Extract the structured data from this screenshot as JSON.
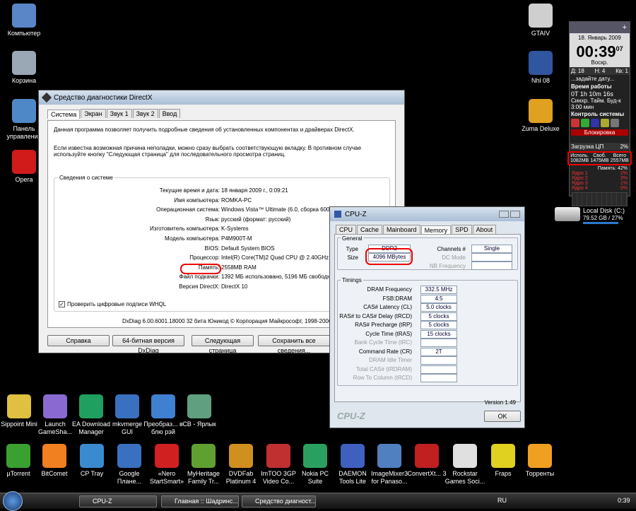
{
  "desktop": {
    "left_icons": [
      {
        "label": "Компьютер",
        "icon": "computer-icon",
        "color": "#5a86c8"
      },
      {
        "label": "Корзина",
        "icon": "recycle-bin-icon",
        "color": "#9aa7b5"
      },
      {
        "label": "Панель управления",
        "icon": "control-panel-icon",
        "color": "#4f88c6"
      },
      {
        "label": "Opera",
        "icon": "opera-icon",
        "color": "#d11a1a"
      }
    ],
    "right_icons": [
      {
        "label": "GTAIV",
        "icon": "gtaiv-icon",
        "color": "#cfcfcf"
      },
      {
        "label": "Nhl 08",
        "icon": "nhl08-icon",
        "color": "#3056a0"
      },
      {
        "label": "Zuma Deluxe",
        "icon": "zuma-icon",
        "color": "#e0a020"
      }
    ],
    "disk": {
      "label": "Local Disk (C:)",
      "info": "79.52 GB / 27%"
    },
    "bottom_row1": [
      {
        "label": "Sippoint Mini",
        "color": "#e0c040"
      },
      {
        "label": "Launch GameSha...",
        "color": "#8a6ad0"
      },
      {
        "label": "EA Download Manager",
        "color": "#20a060"
      },
      {
        "label": "mkvmerge GUI",
        "color": "#3a70c0"
      },
      {
        "label": "Преобраз... в блю рэй",
        "color": "#4080d0"
      },
      {
        "label": "CB - Ярлык",
        "color": "#60a080"
      }
    ],
    "bottom_row2": [
      {
        "label": "µTorrent",
        "color": "#3aa030"
      },
      {
        "label": "BitComet",
        "color": "#f08020"
      },
      {
        "label": "CP Tray",
        "color": "#3a8ad0"
      },
      {
        "label": "Google Плане...",
        "color": "#3a70c0"
      },
      {
        "label": "«Nero StartSmart»",
        "color": "#d02020"
      },
      {
        "label": "MyHeritage Family Tr...",
        "color": "#60a030"
      },
      {
        "label": "DVDFab Platinum 4",
        "color": "#d09020"
      },
      {
        "label": "ImTOO 3GP Video Co...",
        "color": "#c03030"
      },
      {
        "label": "Nokia PC Suite",
        "color": "#2aa060"
      },
      {
        "label": "DAEMON Tools Lite",
        "color": "#4060c0"
      },
      {
        "label": "ImageMixer3 for Panaso...",
        "color": "#5080c0"
      },
      {
        "label": "ConvertXt... 3",
        "color": "#c02020"
      },
      {
        "label": "Rockstar Games Soci...",
        "color": "#e0e0e0"
      },
      {
        "label": "Fraps",
        "color": "#e0d020"
      },
      {
        "label": "Торренты",
        "color": "#f0a020"
      }
    ]
  },
  "gadget": {
    "plus": "+",
    "date": "18. Январь 2009",
    "time": "00:39",
    "seconds": "07",
    "weekday": "Воскр.",
    "d_label": "Д: 18",
    "h_label": "Н: 4",
    "k_label": "Кв: 1",
    "task": "...задайте дату...",
    "uptime_title": "Время работы",
    "uptime": "0T 1h 10m 16s",
    "sync": "Синхр. Тайм. Буд-к",
    "alarm": "3:00 мин",
    "control": "Контроль системы",
    "lock": "Блокировка",
    "cpu_title": "Загрузка ЦП",
    "cpu_pct": "2%",
    "mem_used_lbl": "Исполь.",
    "mem_free_lbl": "Своб.",
    "mem_total_lbl": "Всего",
    "mem_used": "1082MB",
    "mem_free": "1475MB",
    "mem_total": "2557MB",
    "mem_pct": "Память: 42%",
    "cores": [
      {
        "name": "Ядро 1",
        "v": "2%"
      },
      {
        "name": "Ядро 2",
        "v": "3%"
      },
      {
        "name": "Ядро 3",
        "v": "1%"
      },
      {
        "name": "Ядро 4",
        "v": "0%"
      }
    ]
  },
  "dxdiag": {
    "title": "Средство диагностики DirectX",
    "tabs": [
      "Система",
      "Экран",
      "Звук 1",
      "Звук 2",
      "Ввод"
    ],
    "intro1": "Данная программа позволяет получить подробные сведения об установленных компонентах и драйверах DirectX.",
    "intro2": "Если известна возможная причина неполадки, можно сразу выбрать соответствующую вкладку. В противном случае используйте кнопку \"Следующая страница\" для последовательного просмотра страниц.",
    "group": "Сведения о системе",
    "rows": [
      {
        "k": "Текущие время и дата:",
        "v": "18 января 2009 г., 0:09:21"
      },
      {
        "k": "Имя компьютера:",
        "v": "ROMKA-PC"
      },
      {
        "k": "Операционная система:",
        "v": "Windows Vista™ Ultimate (6.0, сборка 6001)"
      },
      {
        "k": "Язык:",
        "v": "русский (формат: русский)"
      },
      {
        "k": "Изготовитель компьютера:",
        "v": "K-Systems"
      },
      {
        "k": "Модель компьютера:",
        "v": "P4M900T-M"
      },
      {
        "k": "BIOS:",
        "v": "Default System BIOS"
      },
      {
        "k": "Процессор:",
        "v": "Intel(R) Core(TM)2 Quad CPU          @ 2.40GHz (4 CPUs), ~2"
      },
      {
        "k": "Память:",
        "v": "2558MB RAM"
      },
      {
        "k": "Файл подкачки:",
        "v": "1392 МБ использовано, 5196 МБ свободно"
      },
      {
        "k": "Версия DirectX:",
        "v": "DirectX 10"
      }
    ],
    "checkbox": "Проверить цифровые подписи WHQL",
    "footer": "DxDiag 6.00.6001.18000 32 бита Юникод  © Корпорация Майкрософт, 1998-2006",
    "buttons": [
      "Справка",
      "64-битная версия DxDiag",
      "Следующая страница",
      "Сохранить все сведения..."
    ]
  },
  "cpuz": {
    "title": "CPU-Z",
    "tabs": [
      "CPU",
      "Cache",
      "Mainboard",
      "Memory",
      "SPD",
      "About"
    ],
    "general": "General",
    "type_lbl": "Type",
    "type": "DDR2",
    "size_lbl": "Size",
    "size": "4096 MBytes",
    "channels_lbl": "Channels #",
    "channels": "Single",
    "dc_lbl": "DC Mode",
    "nb_lbl": "NB Frequency",
    "timings": "Timings",
    "trows": [
      {
        "k": "DRAM Frequency",
        "v": "332.5 MHz",
        "on": true
      },
      {
        "k": "FSB:DRAM",
        "v": "4:5",
        "on": true
      },
      {
        "k": "CAS# Latency (CL)",
        "v": "5.0 clocks",
        "on": true
      },
      {
        "k": "RAS# to CAS# Delay (tRCD)",
        "v": "5 clocks",
        "on": true
      },
      {
        "k": "RAS# Precharge (tRP)",
        "v": "5 clocks",
        "on": true
      },
      {
        "k": "Cycle Time (tRAS)",
        "v": "15 clocks",
        "on": true
      },
      {
        "k": "Bank Cycle Time (tRC)",
        "v": "",
        "on": false
      },
      {
        "k": "Command Rate (CR)",
        "v": "2T",
        "on": true
      },
      {
        "k": "DRAM Idle Timer",
        "v": "",
        "on": false
      },
      {
        "k": "Total CAS# (tRDRAM)",
        "v": "",
        "on": false
      },
      {
        "k": "Row To Column (tRCD)",
        "v": "",
        "on": false
      }
    ],
    "version": "Version 1.49",
    "brand": "CPU-Z",
    "ok": "OK"
  },
  "taskbar": {
    "items": [
      "CPU-Z",
      "Главная :: Шадринс...",
      "Средство диагност..."
    ],
    "lang": "RU",
    "clock": "0:39"
  }
}
